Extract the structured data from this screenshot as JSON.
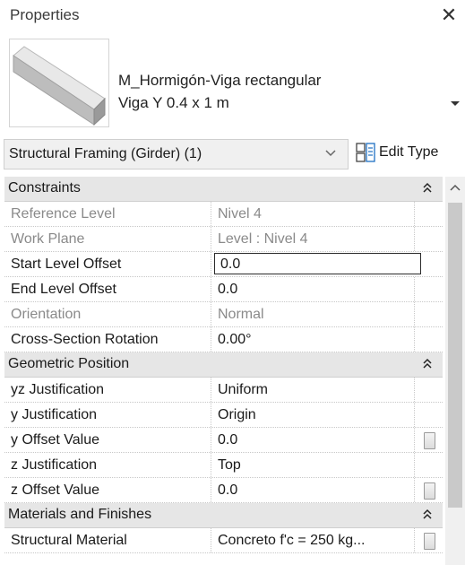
{
  "panel": {
    "title": "Properties",
    "close_icon": "close-icon"
  },
  "type_selector": {
    "family": "M_Hormigón-Viga rectangular",
    "type": "Viga Y 0.4  x 1 m"
  },
  "filter": {
    "selected": "Structural Framing (Girder) (1)"
  },
  "edit_type": {
    "label": "Edit Type"
  },
  "sections": [
    {
      "title": "Constraints",
      "rows": [
        {
          "name": "Reference Level",
          "value": "Nivel 4",
          "readonly": true
        },
        {
          "name": "Work Plane",
          "value": "Level : Nivel 4",
          "readonly": true
        },
        {
          "name": "Start Level Offset",
          "value": "0.0",
          "readonly": false,
          "active": true
        },
        {
          "name": "End Level Offset",
          "value": "0.0",
          "readonly": false
        },
        {
          "name": "Orientation",
          "value": "Normal",
          "readonly": true
        },
        {
          "name": "Cross-Section Rotation",
          "value": "0.00°",
          "readonly": false
        }
      ]
    },
    {
      "title": "Geometric Position",
      "rows": [
        {
          "name": "yz Justification",
          "value": "Uniform",
          "readonly": false
        },
        {
          "name": "y Justification",
          "value": "Origin",
          "readonly": false
        },
        {
          "name": "y Offset Value",
          "value": "0.0",
          "readonly": false,
          "assoc": true
        },
        {
          "name": "z Justification",
          "value": "Top",
          "readonly": false
        },
        {
          "name": "z Offset Value",
          "value": "0.0",
          "readonly": false,
          "assoc": true
        }
      ]
    },
    {
      "title": "Materials and Finishes",
      "rows": [
        {
          "name": "Structural Material",
          "value": "Concreto f'c = 250 kg...",
          "readonly": false,
          "assoc": true
        }
      ]
    }
  ],
  "colors": {
    "section_bg": "#e6e6e6",
    "readonly_text": "#8a8a8a"
  }
}
